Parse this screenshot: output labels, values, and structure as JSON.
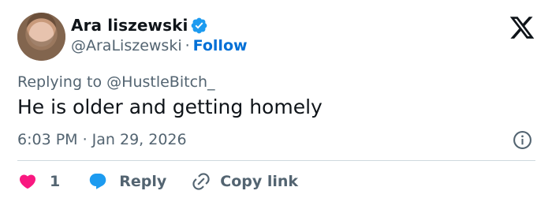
{
  "author": {
    "display_name": "Ara liszewski",
    "handle": "@AraLiszewski",
    "separator": "·",
    "follow_label": "Follow"
  },
  "tweet": {
    "replying_to": "Replying to @HustleBitch_",
    "text": "He is older and getting homely",
    "timestamp": "6:03 PM · Jan 29, 2026"
  },
  "actions": {
    "like_count": "1",
    "reply_label": "Reply",
    "copy_link_label": "Copy link"
  },
  "icons": {
    "verified": "verified-badge-icon",
    "brand": "x-logo-icon",
    "info": "info-icon",
    "like": "heart-icon",
    "reply": "reply-bubble-icon",
    "copy": "link-icon"
  },
  "colors": {
    "like": "#f91880",
    "reply": "#1d9bf0",
    "follow": "#006fd6",
    "verified": "#1d9bf0",
    "secondary_text": "#536471"
  }
}
